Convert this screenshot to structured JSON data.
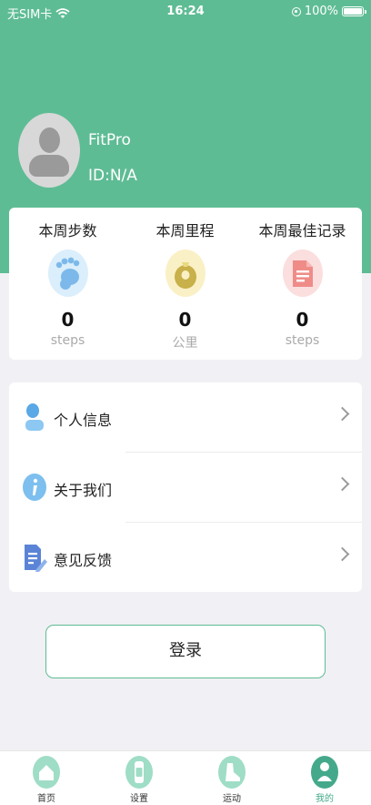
{
  "status_bar": {
    "carrier": "无SIM卡",
    "time": "16:24",
    "battery": "100%"
  },
  "profile": {
    "name": "FitPro",
    "id": "ID:N/A"
  },
  "stats": [
    {
      "title": "本周步数",
      "value": "0",
      "unit": "steps",
      "icon": "footprint-icon",
      "color": "#dbeefb",
      "accent": "#7cb9ea"
    },
    {
      "title": "本周里程",
      "value": "0",
      "unit": "公里",
      "icon": "distance-icon",
      "color": "#faf0c6",
      "accent": "#c8b04a"
    },
    {
      "title": "本周最佳记录",
      "value": "0",
      "unit": "steps",
      "icon": "record-icon",
      "color": "#fbdede",
      "accent": "#ef8c88"
    }
  ],
  "menu": [
    {
      "label": "个人信息",
      "icon": "person-icon"
    },
    {
      "label": "关于我们",
      "icon": "info-icon"
    },
    {
      "label": "意见反馈",
      "icon": "feedback-icon"
    }
  ],
  "login_label": "登录",
  "tabs": [
    {
      "label": "首页",
      "icon": "home-icon"
    },
    {
      "label": "设置",
      "icon": "watch-icon"
    },
    {
      "label": "运动",
      "icon": "shoe-icon"
    },
    {
      "label": "我的",
      "icon": "profile-icon",
      "active": true
    }
  ],
  "colors": {
    "brand": "#5ebc94",
    "tab_active": "#44a98a",
    "background": "#f1f0f5"
  }
}
